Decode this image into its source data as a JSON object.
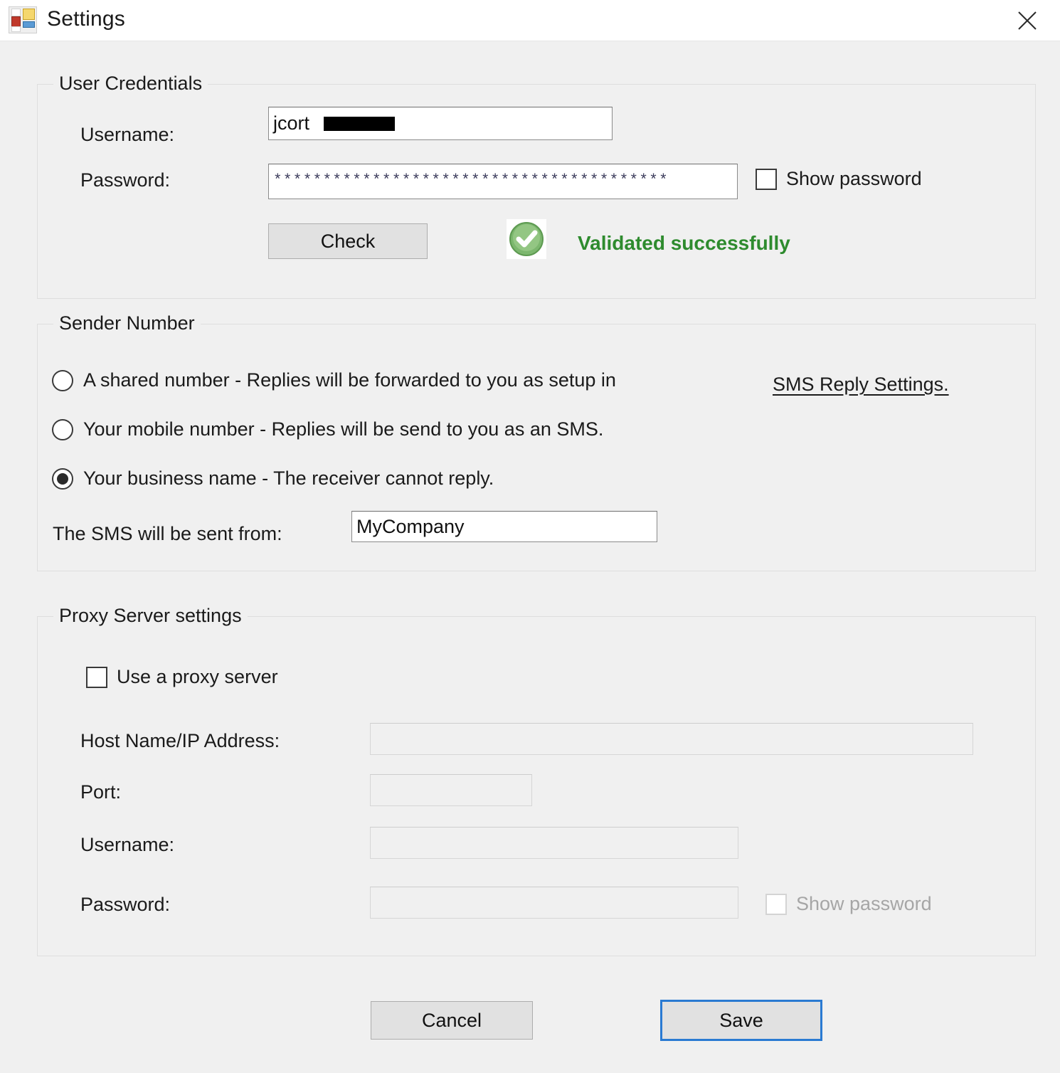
{
  "window": {
    "title": "Settings",
    "icon": "app-settings-icon",
    "close_icon": "close-icon",
    "background_color": "#f0f0f0",
    "titlebar_color": "#ffffff"
  },
  "credentials": {
    "group_title": "User Credentials",
    "username_label": "Username:",
    "username_value": "jcort",
    "username_redacted": true,
    "password_label": "Password:",
    "password_value": "****************************************",
    "show_password_label": "Show password",
    "show_password_checked": false,
    "check_button_label": "Check",
    "validation_text": "Validated successfully",
    "validation_icon": "green-check-circle-icon",
    "validation_color": "#2e8b2e"
  },
  "sender": {
    "group_title": "Sender Number",
    "options": [
      {
        "label": "A shared number - Replies will be forwarded to you as setup in",
        "checked": false
      },
      {
        "label": "Your mobile number - Replies will be send to you as an SMS.",
        "checked": false
      },
      {
        "label": "Your business name - The receiver cannot reply.",
        "checked": true
      }
    ],
    "reply_settings_link": "SMS Reply Settings.",
    "sent_from_label": "The SMS will be sent from:",
    "sent_from_value": "MyCompany"
  },
  "proxy": {
    "group_title": "Proxy Server settings",
    "use_proxy_label": "Use a proxy server",
    "use_proxy_checked": false,
    "host_label": "Host Name/IP Address:",
    "host_value": "",
    "port_label": "Port:",
    "port_value": "",
    "username_label": "Username:",
    "username_value": "",
    "password_label": "Password:",
    "password_value": "",
    "show_password_label": "Show password",
    "show_password_checked": false,
    "disabled": true
  },
  "footer": {
    "cancel_label": "Cancel",
    "save_label": "Save",
    "save_is_default": true,
    "save_focus_color": "#2a7ad2"
  }
}
